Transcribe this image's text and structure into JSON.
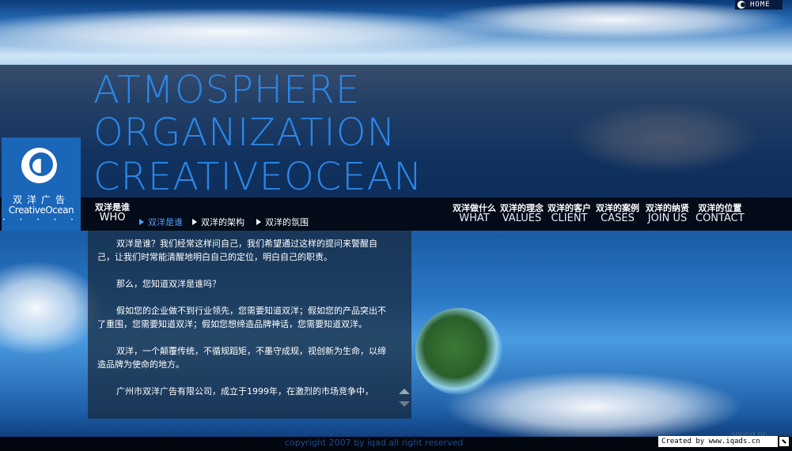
{
  "header": {
    "home_label": "HOME"
  },
  "headline": {
    "line1": "ATMOSPHERE",
    "line2": "ORGANIZATION",
    "line3": "CREATIVEOCEAN"
  },
  "logo": {
    "cn": "双洋广告",
    "en": "CreativeOcean",
    "dots": "• • • • •"
  },
  "section": {
    "cn": "双洋是谁",
    "en": "WHO"
  },
  "subnav": [
    {
      "label": "双洋是谁",
      "active": true
    },
    {
      "label": "双洋的架构",
      "active": false
    },
    {
      "label": "双洋的氛围",
      "active": false
    }
  ],
  "nav": [
    {
      "cn": "双洋做什么",
      "en": "WHAT"
    },
    {
      "cn": "双洋的理念",
      "en": "VALUES"
    },
    {
      "cn": "双洋的客户",
      "en": "CLIENT"
    },
    {
      "cn": "双洋的案例",
      "en": "CASES"
    },
    {
      "cn": "双洋的纳贤",
      "en": "JOIN US"
    },
    {
      "cn": "双洋的位置",
      "en": "CONTACT"
    }
  ],
  "content": {
    "paragraphs": [
      "双洋是谁？我们经常这样问自己，我们希望通过这样的提问来警醒自己，让我们时常能清醒地明白自己的定位，明白自己的职责。",
      "那么，您知道双洋是谁吗？",
      "假如您的企业做不到行业领先，您需要知道双洋；假如您的产品突出不了重围，您需要知道双洋；假如您想缔造品牌神话，您需要知道双洋。",
      "双洋，一个颠覆传统，不循规蹈矩，不墨守成规，视创新为生命，以缔造品牌为使命的地方。",
      "广州市双洋广告有限公司，成立于1999年，在激烈的市场竞争中，"
    ]
  },
  "footer": {
    "copyright": "copyright 2007 by iqad all right reserved",
    "sound": "sound on",
    "created_by": "Created by www.iqads.cn"
  }
}
